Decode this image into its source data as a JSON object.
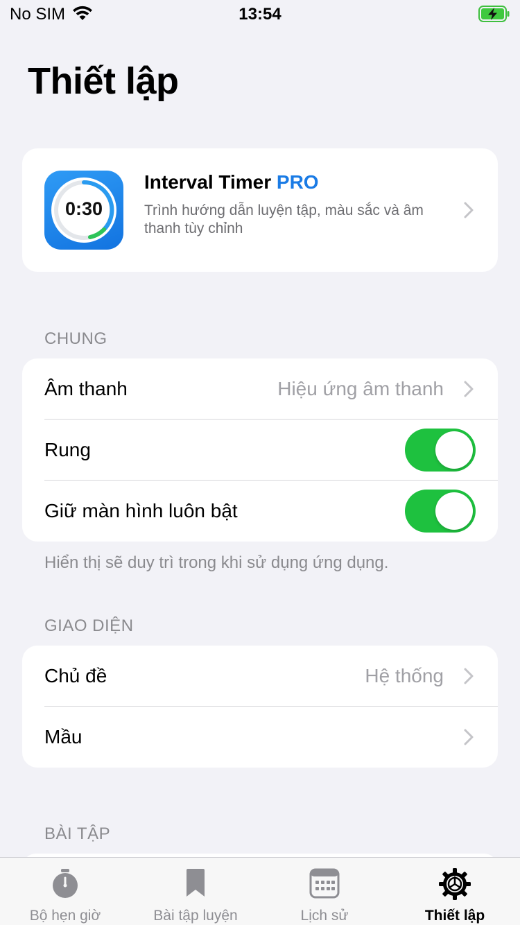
{
  "status_bar": {
    "carrier": "No SIM",
    "time": "13:54",
    "battery_state": "charging"
  },
  "page": {
    "title": "Thiết lập"
  },
  "pro_card": {
    "title": "Interval Timer",
    "title_badge": "PRO",
    "description": "Trình hướng dẫn luyện tập, màu sắc và âm thanh tùy chỉnh",
    "icon_time": "0:30"
  },
  "general": {
    "header": "CHUNG",
    "sound": {
      "label": "Âm thanh",
      "value": "Hiệu ứng âm thanh"
    },
    "vibrate": {
      "label": "Rung",
      "on": true
    },
    "keep_screen_on": {
      "label": "Giữ màn hình luôn bật",
      "on": true
    },
    "footer": "Hiển thị sẽ duy trì trong khi sử dụng ứng dụng."
  },
  "appearance": {
    "header": "GIAO DIỆN",
    "theme": {
      "label": "Chủ đề",
      "value": "Hệ thống"
    },
    "color": {
      "label": "Mầu"
    }
  },
  "workouts": {
    "header": "BÀI TẬP"
  },
  "tab_bar": {
    "tabs": [
      {
        "label": "Bộ hẹn giờ",
        "icon": "stopwatch-icon"
      },
      {
        "label": "Bài tập luyện",
        "icon": "bookmark-icon"
      },
      {
        "label": "Lịch sử",
        "icon": "calendar-icon"
      },
      {
        "label": "Thiết lập",
        "icon": "gear-icon",
        "active": true
      }
    ]
  },
  "colors": {
    "accent_blue": "#1a7be5",
    "toggle_on": "#1ec13f",
    "background": "#f2f2f7",
    "secondary_text": "#8a8a8e"
  }
}
